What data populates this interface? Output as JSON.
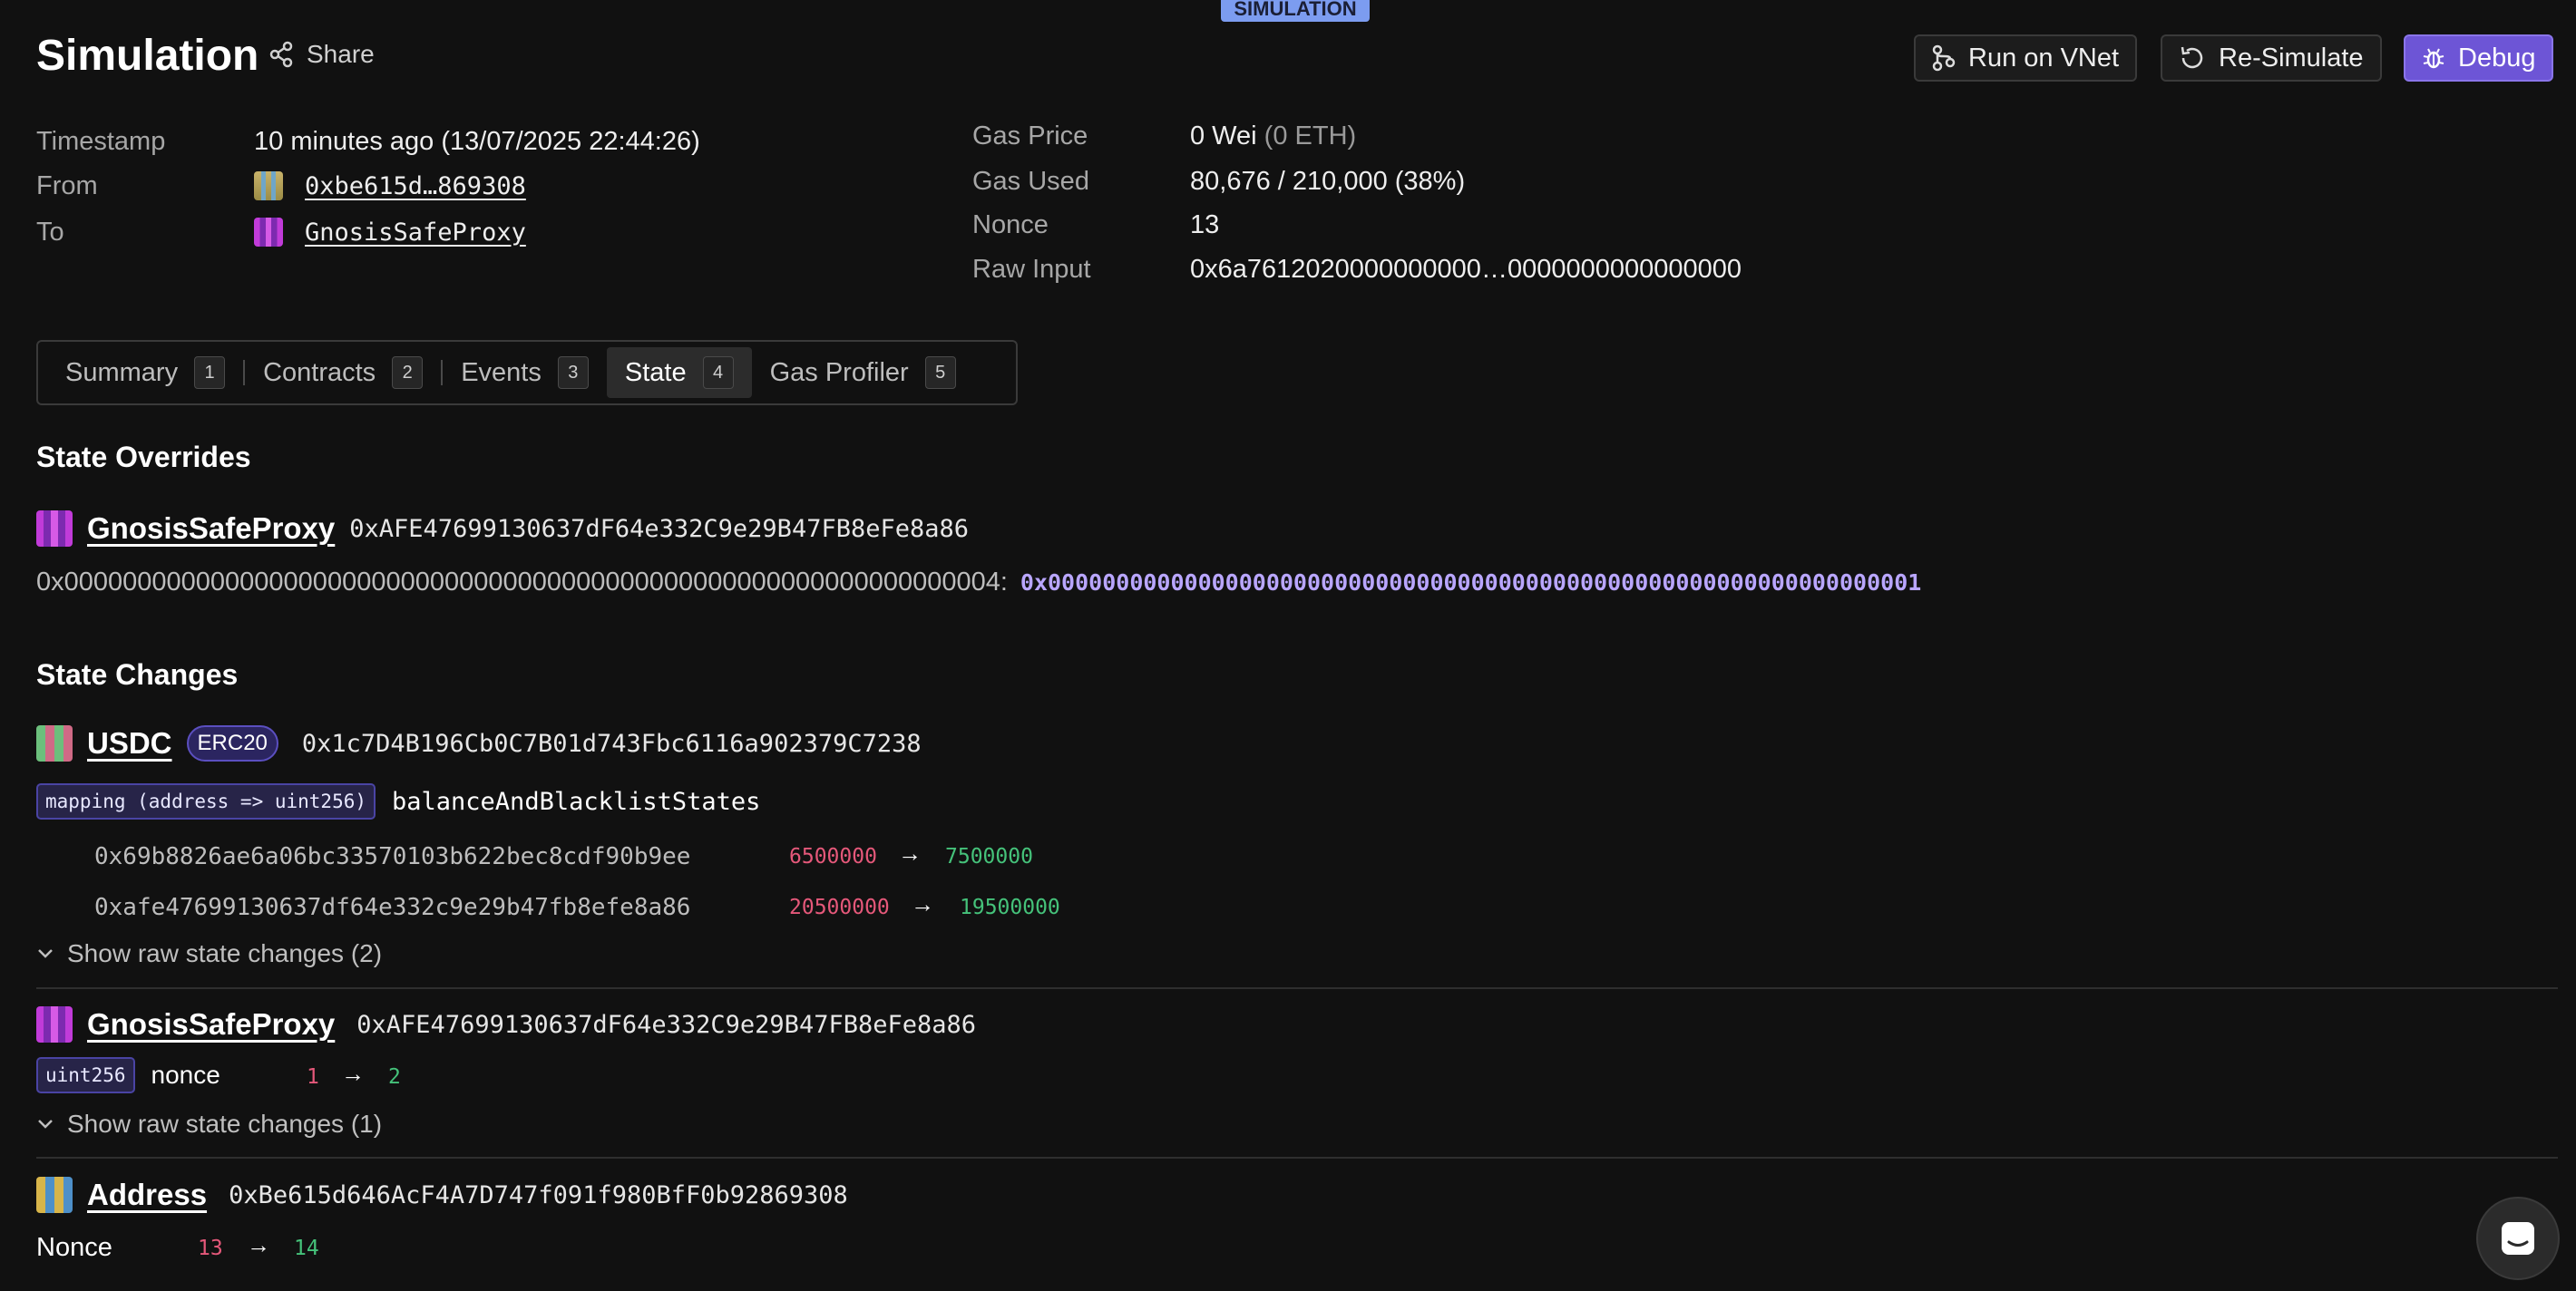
{
  "badge": "SIMULATION",
  "header": {
    "title": "Simulation",
    "share": "Share",
    "buttons": {
      "run_vnet": "Run on VNet",
      "resimulate": "Re-Simulate",
      "debug": "Debug"
    }
  },
  "details_left": [
    {
      "label": "Timestamp",
      "value": "10 minutes ago (13/07/2025 22:44:26)"
    },
    {
      "label": "From",
      "value": "0xbe615d…869308"
    },
    {
      "label": "To",
      "value": "GnosisSafeProxy"
    }
  ],
  "details_right": [
    {
      "label": "Gas Price",
      "value": "0 Wei",
      "secondary": "(0 ETH)"
    },
    {
      "label": "Gas Used",
      "value": "80,676 / 210,000 (38%)"
    },
    {
      "label": "Nonce",
      "value": "13"
    },
    {
      "label": "Raw Input",
      "value": "0x6a7612020000000000…0000000000000000"
    }
  ],
  "tabs": [
    {
      "label": "Summary",
      "num": "1"
    },
    {
      "label": "Contracts",
      "num": "2"
    },
    {
      "label": "Events",
      "num": "3"
    },
    {
      "label": "State",
      "num": "4"
    },
    {
      "label": "Gas Profiler",
      "num": "5"
    }
  ],
  "overrides": {
    "title": "State Overrides",
    "contract": "GnosisSafeProxy",
    "address": "0xAFE47699130637dF64e332C9e29B47FB8eFe8a86",
    "slot": "0x0000000000000000000000000000000000000000000000000000000000000004:",
    "slot_value": "0x0000000000000000000000000000000000000000000000000000000000000001"
  },
  "changes": {
    "title": "State Changes",
    "usdc": {
      "name": "USDC",
      "badge": "ERC20",
      "address": "0x1c7D4B196Cb0C7B01d743Fbc6116a902379C7238",
      "type_tag": "mapping (address => uint256)",
      "variable": "balanceAndBlacklistStates",
      "rows": [
        {
          "key": "0x69b8826ae6a06bc33570103b622bec8cdf90b9ee",
          "old": "6500000",
          "new": "7500000"
        },
        {
          "key": "0xafe47699130637df64e332c9e29b47fb8efe8a86",
          "old": "20500000",
          "new": "19500000"
        }
      ],
      "raw_toggle": "Show raw state changes (2)"
    },
    "gnosis": {
      "name": "GnosisSafeProxy",
      "address": "0xAFE47699130637dF64e332C9e29B47FB8eFe8a86",
      "type_tag": "uint256",
      "variable": "nonce",
      "old": "1",
      "new": "2",
      "raw_toggle": "Show raw state changes (1)"
    },
    "address": {
      "name": "Address",
      "address": "0xBe615d646AcF4A7D747f091f980BfF0b92869308",
      "label": "Nonce",
      "old": "13",
      "new": "14"
    }
  },
  "arrow": "→"
}
